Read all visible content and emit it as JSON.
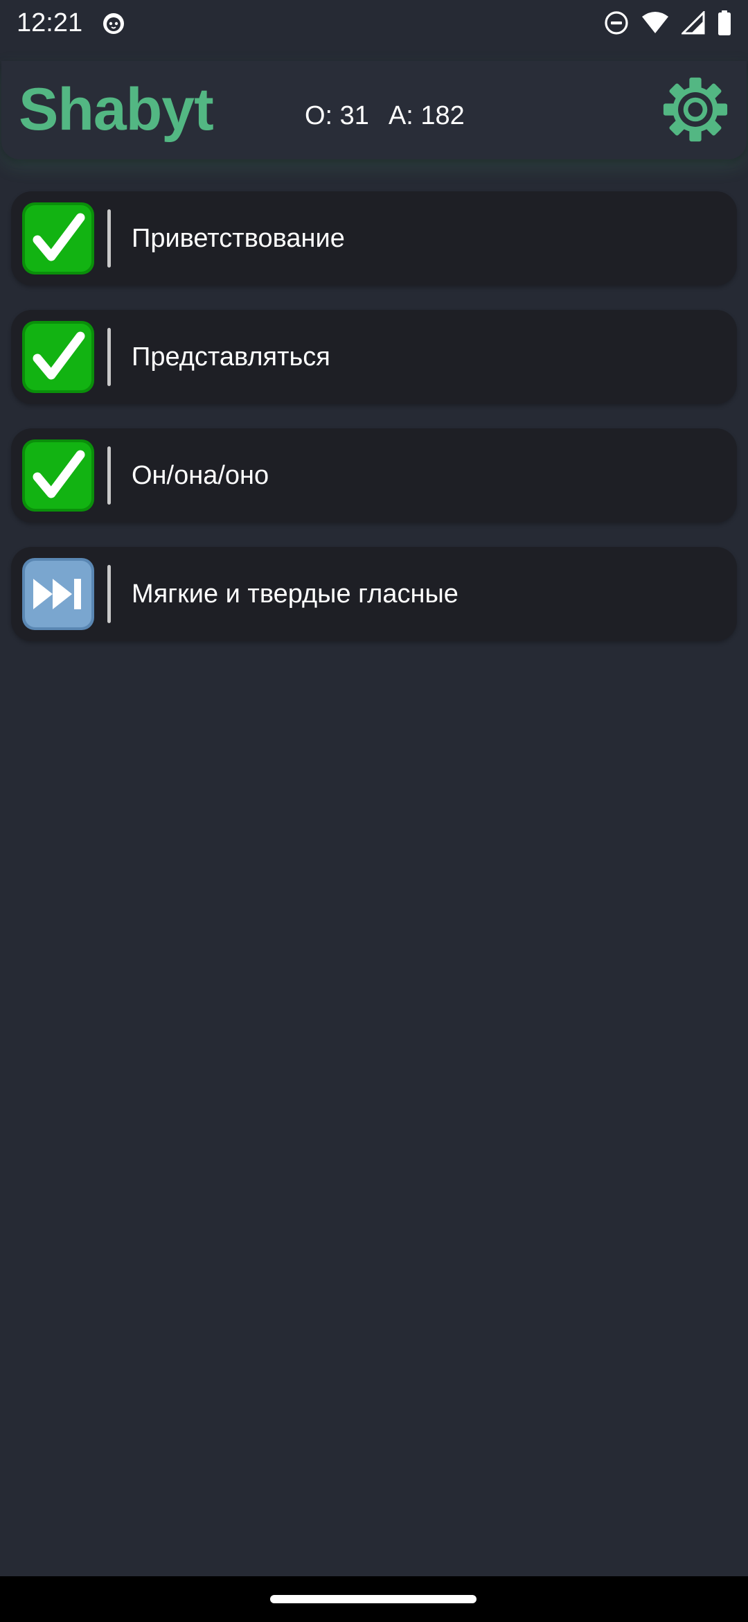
{
  "status_bar": {
    "time": "12:21",
    "icons": [
      "cat-notification-icon",
      "do-not-disturb-icon",
      "wifi-icon",
      "signal-icon",
      "battery-icon"
    ]
  },
  "header": {
    "title": "Shabyt",
    "stats": {
      "o_label": "O: 31",
      "a_label": "A: 182"
    },
    "settings_icon": "gear-icon"
  },
  "lessons": [
    {
      "label": "Приветствование",
      "status": "completed",
      "icon": "checkmark-icon"
    },
    {
      "label": "Представляться",
      "status": "completed",
      "icon": "checkmark-icon"
    },
    {
      "label": "Он/она/оно",
      "status": "completed",
      "icon": "checkmark-icon"
    },
    {
      "label": "Мягкие и твердые гласные",
      "status": "next",
      "icon": "fast-forward-icon"
    }
  ],
  "colors": {
    "accent": "#53b783",
    "background": "#262a34",
    "header_bg": "#292d38",
    "card_bg": "#1e1f25",
    "check_green": "#12b312",
    "skip_blue": "#7aa6cf"
  }
}
